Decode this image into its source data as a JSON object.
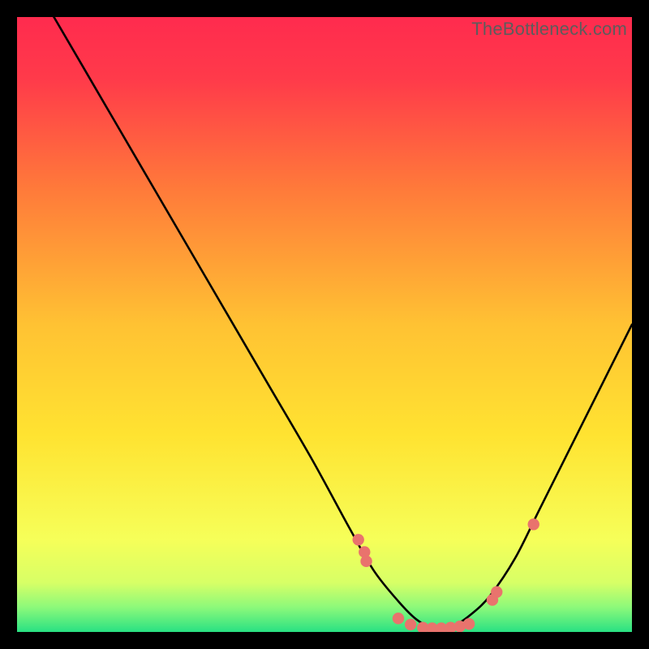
{
  "watermark": "TheBottleneck.com",
  "colors": {
    "bg": "#000000",
    "gradient_top": "#ff2b4e",
    "gradient_mid": "#ffd400",
    "gradient_low": "#f3ff66",
    "gradient_bottom": "#2bdf84",
    "curve": "#000000",
    "dot": "#e9736d"
  },
  "chart_data": {
    "type": "line",
    "title": "",
    "xlabel": "",
    "ylabel": "",
    "xlim": [
      0,
      100
    ],
    "ylim": [
      0,
      100
    ],
    "curve": {
      "name": "bottleneck-curve",
      "x": [
        0,
        6,
        13,
        20,
        27,
        34,
        41,
        48,
        54,
        58,
        62,
        65,
        68,
        71,
        74,
        77,
        81,
        85,
        90,
        95,
        100
      ],
      "y": [
        110,
        100,
        88,
        76,
        64,
        52,
        40,
        28,
        17,
        10,
        5,
        2,
        0.5,
        1,
        3,
        6,
        12,
        20,
        30,
        40,
        50
      ]
    },
    "points": {
      "name": "sample-points",
      "x": [
        55.5,
        56.5,
        56.8,
        62.0,
        64.0,
        66.0,
        67.5,
        69.0,
        70.5,
        72.0,
        73.5,
        77.3,
        78.0,
        84.0
      ],
      "y": [
        15.0,
        13.0,
        11.5,
        2.2,
        1.2,
        0.7,
        0.6,
        0.6,
        0.7,
        0.9,
        1.3,
        5.2,
        6.5,
        17.5
      ]
    }
  }
}
